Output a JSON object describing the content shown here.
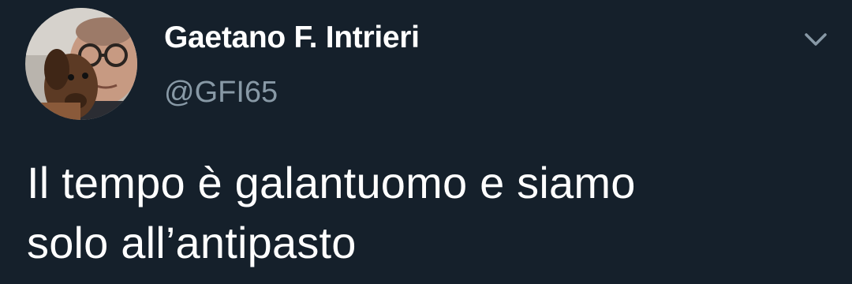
{
  "tweet": {
    "author": {
      "display_name": "Gaetano F. Intrieri",
      "handle": "@GFI65",
      "avatar_icon": "profile-photo"
    },
    "menu_icon": "chevron-down-icon",
    "text_lines": [
      "Il tempo è galantuomo e siamo",
      "solo all’antipasto"
    ]
  },
  "colors": {
    "background": "#15202b",
    "primary_text": "#ffffff",
    "secondary_text": "#8899a6"
  }
}
